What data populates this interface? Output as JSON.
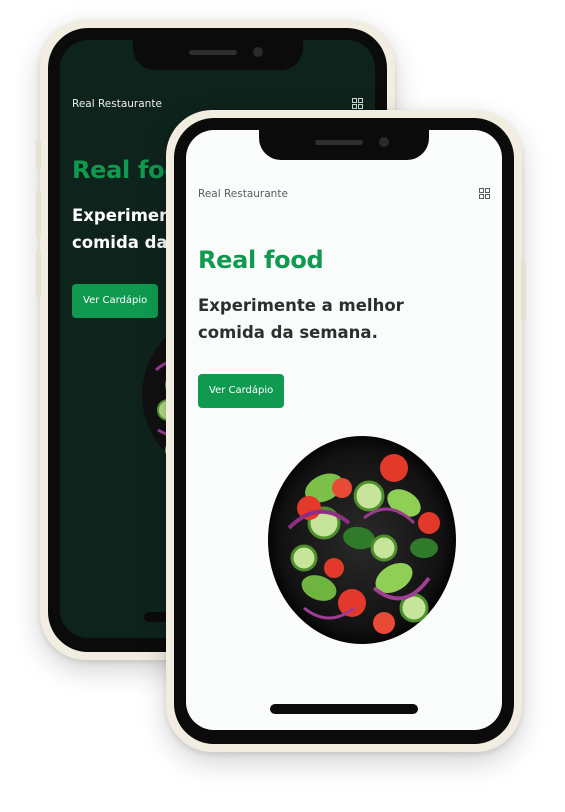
{
  "app": {
    "brand": "Real Restaurante",
    "hero_title": "Real food",
    "hero_subtitle": "Experimente a melhor comida da semana.",
    "cta_label": "Ver Cardápio",
    "menu_icon": "grid-menu-icon",
    "hero_image": "salad-bowl-image"
  },
  "themes": {
    "dark": {
      "background": "#0f231d",
      "text": "#ffffff",
      "accent": "#0f9a4f"
    },
    "light": {
      "background": "#f9fcfb",
      "text": "#2b2f2e",
      "accent": "#0f9a4f"
    }
  },
  "device": {
    "frame_color": "#f1ede1",
    "bezel_color": "#0b0b0b"
  }
}
